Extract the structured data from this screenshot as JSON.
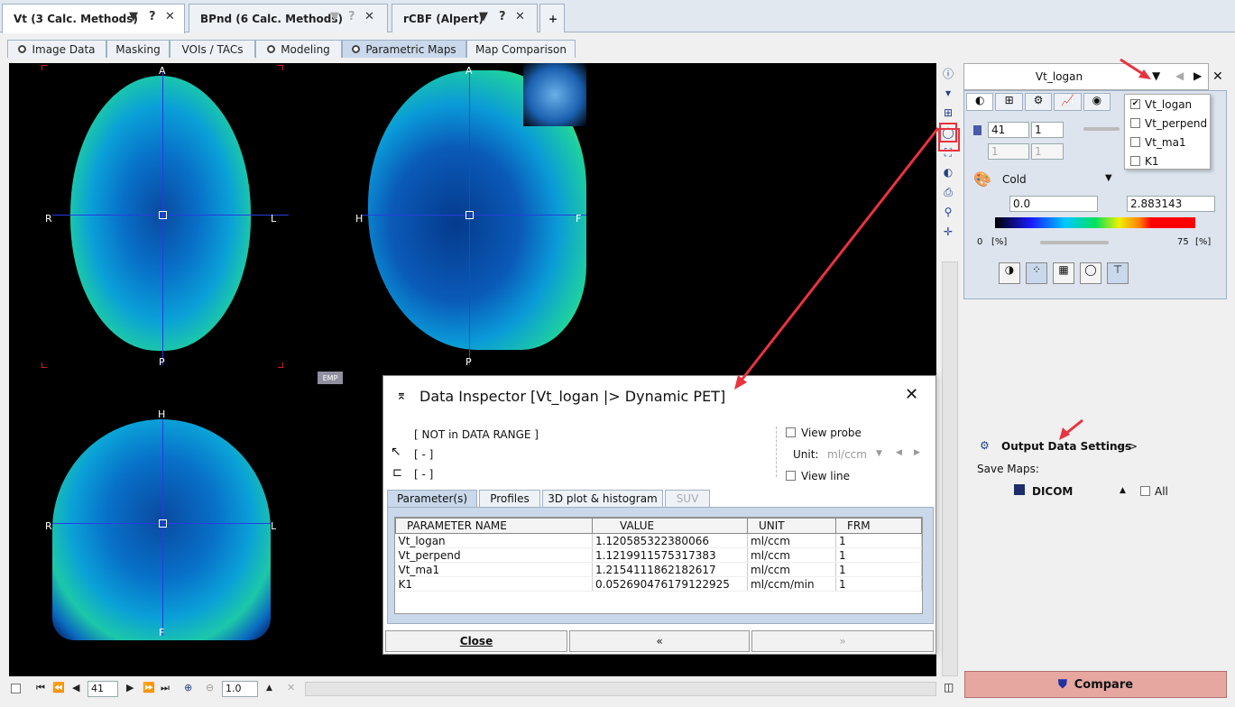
{
  "top_tabs": [
    {
      "label": "Vt (3 Calc. Methods)",
      "active": true
    },
    {
      "label": "BPnd (6 Calc. Methods)",
      "active": false
    },
    {
      "label": "rCBF (Alpert)",
      "active": false
    }
  ],
  "tab_controls": {
    "menu": "▼",
    "help": "?",
    "close": "✕",
    "add": "+"
  },
  "sub_tabs": [
    {
      "label": "Image Data",
      "radio": true
    },
    {
      "label": "Masking",
      "radio": false
    },
    {
      "label": "VOIs / TACs",
      "radio": false
    },
    {
      "label": "Modeling",
      "radio": true
    },
    {
      "label": "Parametric Maps",
      "radio": true,
      "active": true
    },
    {
      "label": "Map Comparison",
      "radio": false
    }
  ],
  "viewer": {
    "axial": {
      "top": "A",
      "bottom": "P",
      "left": "R",
      "right": "L"
    },
    "sagittal": {
      "top": "A",
      "bottom": "P",
      "left": "H",
      "right": "F"
    },
    "coronal": {
      "top": "H",
      "bottom": "F",
      "left": "R",
      "right": "L"
    },
    "emp_badge": "EMP"
  },
  "map_selector": {
    "value": "Vt_logan",
    "close": "✕"
  },
  "map_menu": [
    {
      "label": "Vt_logan",
      "checked": true
    },
    {
      "label": "Vt_perpend",
      "checked": false
    },
    {
      "label": "Vt_ma1",
      "checked": false
    },
    {
      "label": "K1",
      "checked": false
    }
  ],
  "panel": {
    "slice": "41",
    "frame": "1",
    "slice2": "1",
    "frame2": "1",
    "colortable": "Cold",
    "min_value": "0.0",
    "max_value": "2.883143",
    "min_pct": "0",
    "max_pct": "75",
    "pct_unit": "[%]"
  },
  "output": {
    "title": "Output Data Settings",
    "arrow": "--->",
    "save_maps": "Save Maps:",
    "format": "DICOM",
    "all": "All"
  },
  "compare_label": "Compare",
  "dialog": {
    "title": "Data Inspector [Vt_logan |> Dynamic PET]",
    "not_in_range": "[ NOT in DATA RANGE ]",
    "coord1": "[ - ]",
    "coord2": "[ - ]",
    "view_probe": "View probe",
    "unit_label": "Unit:",
    "unit_value": "ml/ccm",
    "view_line": "View line",
    "tabs": [
      "Parameter(s)",
      "Profiles",
      "3D plot & histogram",
      "SUV"
    ],
    "columns": [
      "PARAMETER NAME",
      "VALUE",
      "UNIT",
      "FRM"
    ],
    "rows": [
      {
        "name": "Vt_logan",
        "value": "1.120585322380066",
        "unit": "ml/ccm",
        "frm": "1"
      },
      {
        "name": "Vt_perpend",
        "value": "1.1219911575317383",
        "unit": "ml/ccm",
        "frm": "1"
      },
      {
        "name": "Vt_ma1",
        "value": "1.2154111862182617",
        "unit": "ml/ccm",
        "frm": "1"
      },
      {
        "name": "K1",
        "value": "0.052690476179122925",
        "unit": "ml/ccm/min",
        "frm": "1"
      }
    ],
    "close_btn": "Close",
    "prev_btn": "«",
    "next_btn": "»"
  },
  "bottom": {
    "slice": "41",
    "zoom": "1.0"
  }
}
